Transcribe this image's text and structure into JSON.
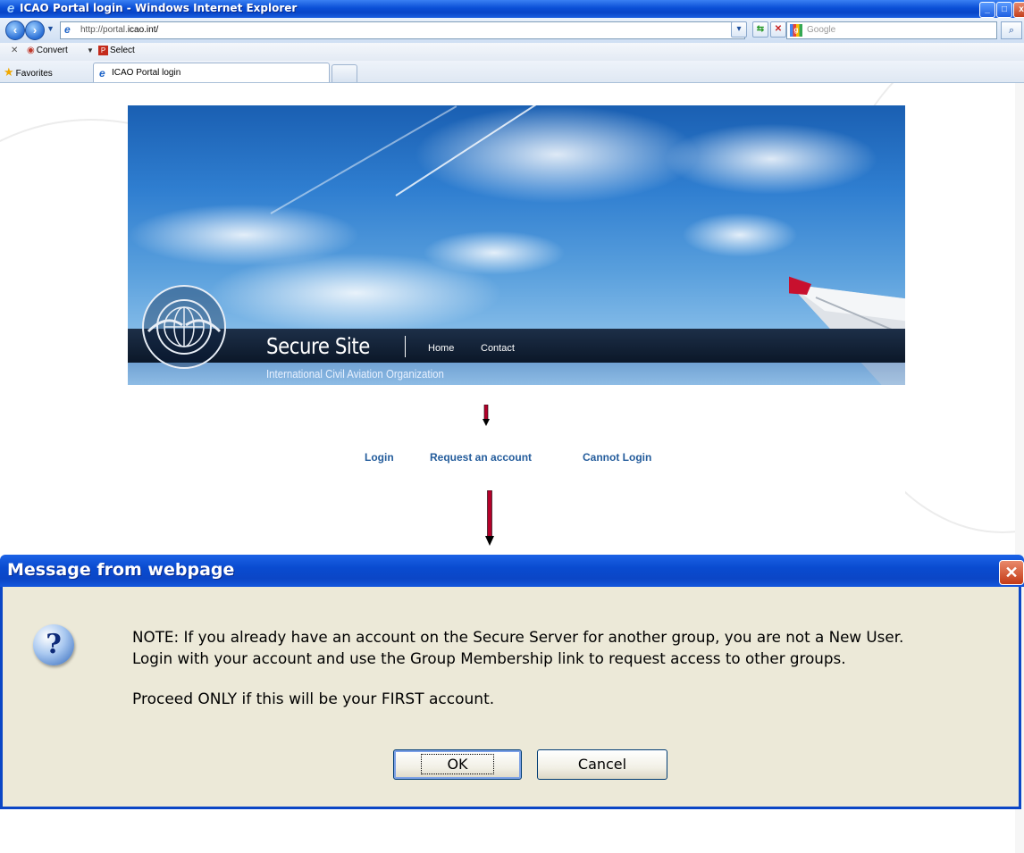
{
  "window": {
    "title": "ICAO Portal login - Windows Internet Explorer"
  },
  "navbar": {
    "url_prefix": "http://portal.",
    "url_domain": "icao.int/",
    "search_placeholder": "Google"
  },
  "command_bar": {
    "close": "✕",
    "convert_label": "Convert",
    "select_label": "Select"
  },
  "favorites_bar": {
    "favorites_label": "Favorites",
    "tab_title": "ICAO Portal login"
  },
  "page": {
    "site_title": "Secure Site",
    "nav_home": "Home",
    "nav_contact": "Contact",
    "org_name": "International Civil Aviation Organization",
    "seal_text": "ICAO • OACI • ИКАО",
    "links": {
      "login": "Login",
      "request": "Request an account",
      "cannot": "Cannot Login"
    }
  },
  "dialog": {
    "title": "Message from webpage",
    "icon": "?",
    "line1": "NOTE: If you already have an account on the Secure Server for another group, you are not a New User.",
    "line2": "Login with your account and use the Group Membership link to request access to other groups.",
    "line3": "Proceed ONLY if this will be your FIRST account.",
    "ok_label": "OK",
    "cancel_label": "Cancel"
  },
  "colors": {
    "link": "#255d9c",
    "arrow": "#b4002a",
    "dialog_bg": "#ece9d8",
    "xp_blue": "#0b46c6"
  }
}
